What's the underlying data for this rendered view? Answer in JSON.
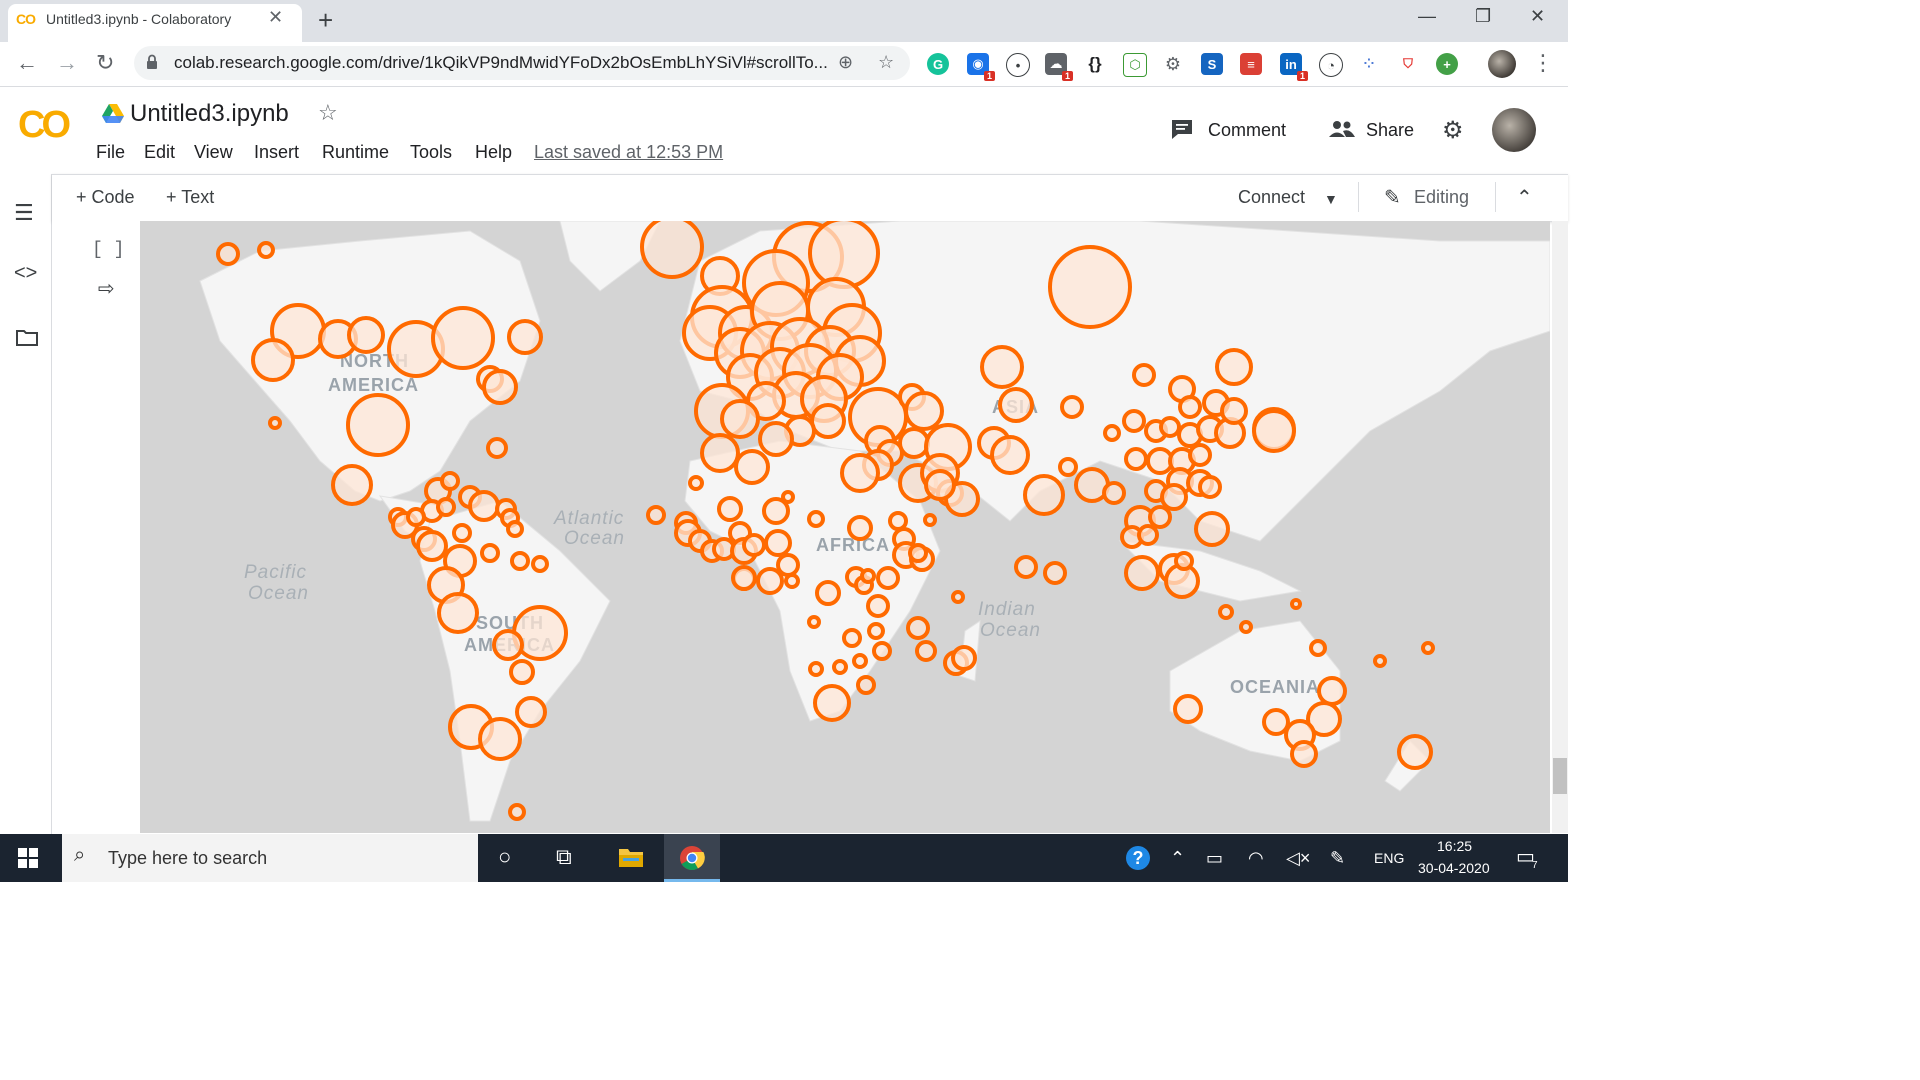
{
  "browser": {
    "tab_title": "Untitled3.ipynb - Colaboratory",
    "tab_favicon": "CO",
    "url": "colab.research.google.com/drive/1kQikVP9ndMwidYFoDx2bOsEmbLhYSiVl#scrollTo...",
    "extension_badges": [
      "1",
      "1",
      "1"
    ]
  },
  "colab": {
    "logo": "CO",
    "notebook_title": "Untitled3.ipynb",
    "menu": [
      "File",
      "Edit",
      "View",
      "Insert",
      "Runtime",
      "Tools",
      "Help"
    ],
    "last_saved": "Last saved at 12:53 PM",
    "comment_label": "Comment",
    "share_label": "Share",
    "add_code_label": "+ Code",
    "add_text_label": "+ Text",
    "connect_label": "Connect",
    "editing_label": "Editing",
    "cell_bracket": "[ ]"
  },
  "map": {
    "marker_color": "#ff6a00",
    "marker_fill": "#fde6d6",
    "labels": {
      "north_america": [
        "NORTH",
        "AMERICA"
      ],
      "south_america": [
        "SOUTH",
        "AMERICA"
      ],
      "africa": "AFRICA",
      "asia": "ASIA",
      "oceania": "OCEANIA",
      "atlantic": [
        "Atlantic",
        "Ocean"
      ],
      "pacific": [
        "Pacific",
        "Ocean"
      ],
      "indian": [
        "Indian",
        "Ocean"
      ]
    }
  },
  "taskbar": {
    "search_placeholder": "Type here to search",
    "language": "ENG",
    "time": "16:25",
    "date": "30-04-2020",
    "notifications": "7"
  }
}
